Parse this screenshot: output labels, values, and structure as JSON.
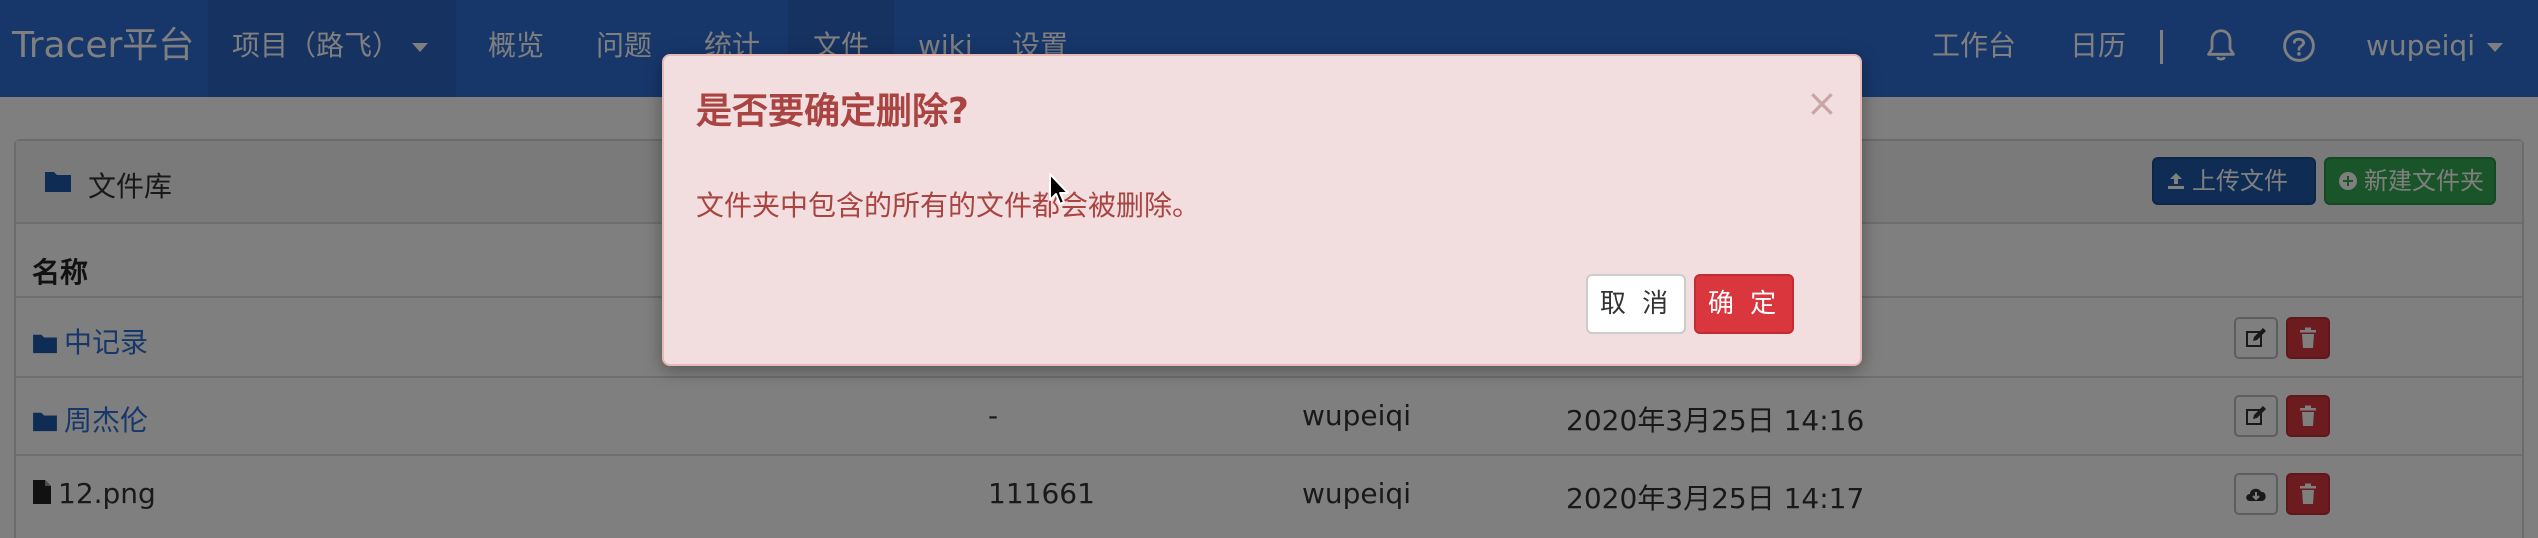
{
  "navbar": {
    "brand": "Tracer平台",
    "project_menu": "项目（路飞）",
    "items": [
      {
        "label": "概览"
      },
      {
        "label": "问题"
      },
      {
        "label": "统计"
      },
      {
        "label": "文件"
      },
      {
        "label": "wiki"
      },
      {
        "label": "设置"
      }
    ],
    "right": {
      "workbench": "工作台",
      "calendar": "日历",
      "separator": "|",
      "user": "wupeiqi"
    },
    "icons": {
      "bell": "bell-icon",
      "help": "question-circle-icon"
    },
    "color": "#2e6fd6"
  },
  "panel": {
    "title": "文件库",
    "upload_button": "上传文件",
    "new_folder_button": "新建文件夹",
    "column_name": "名称",
    "rows": [
      {
        "type": "folder",
        "name": "中记录",
        "size": "",
        "user": "",
        "time": ""
      },
      {
        "type": "folder",
        "name": "周杰伦",
        "size": "-",
        "user": "wupeiqi",
        "time": "2020年3月25日 14:16"
      },
      {
        "type": "file",
        "name": "12.png",
        "size": "111661",
        "user": "wupeiqi",
        "time": "2020年3月25日 14:17"
      }
    ]
  },
  "modal": {
    "title": "是否要确定删除?",
    "close": "×",
    "body": "文件夹中包含的所有的文件都会被删除。",
    "cancel": "取 消",
    "confirm": "确 定",
    "colors": {
      "background": "#f2dede",
      "text": "#a94442",
      "danger": "#d9363e"
    }
  }
}
